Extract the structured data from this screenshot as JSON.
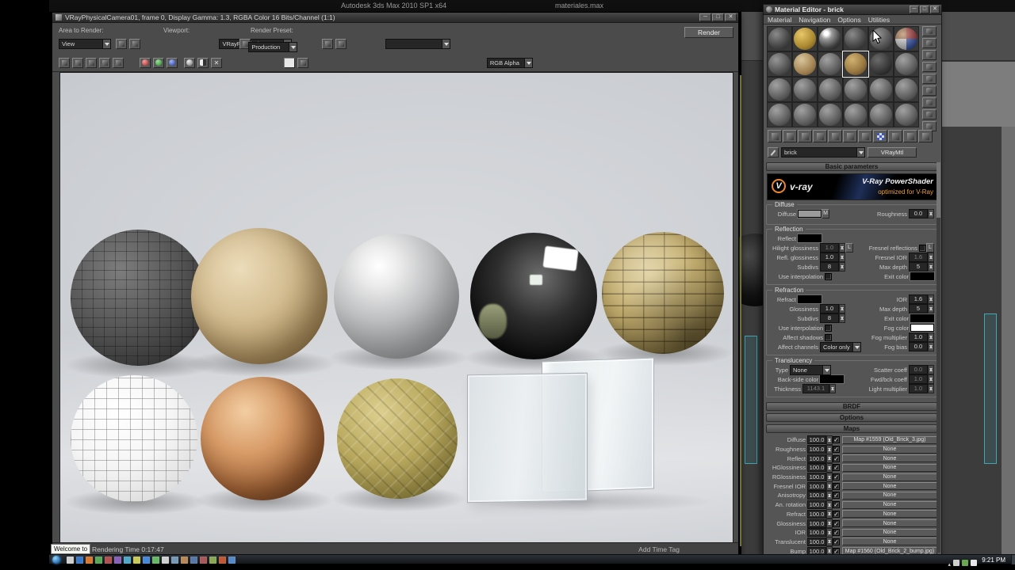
{
  "window": {
    "app_title": "Autodesk 3ds Max 2010 SP1 x64",
    "doc_title": "materiales.max"
  },
  "render_window": {
    "title": "VRayPhysicalCamera01, frame 0, Display Gamma: 1.3, RGBA Color 16 Bits/Channel (1:1)",
    "area_to_render_label": "Area to Render:",
    "area_to_render_value": "View",
    "viewport_label": "Viewport:",
    "viewport_value": "VRayPhysicalCam",
    "render_preset_label": "Render Preset:",
    "render_button_label": "Render",
    "render_mode_value": "Production",
    "channel_display_value": "RGB Alpha",
    "rendering_time": "Rendering Time 0:17:47",
    "add_time_tag": "Add Time Tag",
    "tooltip": "Welcome to M"
  },
  "material_editor": {
    "title": "Material Editor - brick",
    "menu": [
      "Material",
      "Navigation",
      "Options",
      "Utilities"
    ],
    "sample_slots": [
      "bumpy-dark",
      "gold",
      "glossy",
      "bumpy-dark",
      "bumpy-gray",
      "checker",
      "bumpy-gray",
      "tan",
      "gray",
      "brick sel",
      "dark",
      "gray",
      "gray",
      "gray",
      "gray",
      "gray",
      "gray",
      "gray",
      "gray",
      "gray",
      "gray",
      "gray",
      "gray",
      "gray"
    ],
    "material_name": "brick",
    "material_type": "VRayMtl",
    "lock_label": "L",
    "map_shortcut_label": "M",
    "rollouts": {
      "basic": "Basic parameters",
      "brdf": "BRDF",
      "options": "Options",
      "maps": "Maps"
    },
    "banner": {
      "logo_letter": "V",
      "logo_text": "v-ray",
      "title": "V-Ray PowerShader",
      "subtitle": "optimized for V-Ray"
    },
    "groups": {
      "diffuse": "Diffuse",
      "reflection": "Reflection",
      "refraction": "Refraction",
      "translucency": "Translucency"
    },
    "params": {
      "diffuse_label": "Diffuse",
      "roughness_label": "Roughness",
      "roughness_value": "0.0",
      "reflect_label": "Reflect",
      "hilight_glossiness_label": "Hilight glossiness",
      "hilight_glossiness_value": "1.0",
      "fresnel_reflections_label": "Fresnel reflections",
      "refl_glossiness_label": "Refl. glossiness",
      "refl_glossiness_value": "1.0",
      "fresnel_ior_label": "Fresnel IOR",
      "fresnel_ior_value": "1.6",
      "subdivs_label": "Subdivs",
      "reflect_subdivs_value": "8",
      "max_depth_label": "Max depth",
      "reflect_max_depth_value": "5",
      "use_interpolation_label": "Use interpolation",
      "exit_color_label": "Exit color",
      "refract_label": "Refract",
      "ior_label": "IOR",
      "ior_value": "1.6",
      "refract_glossiness_label": "Glossiness",
      "refract_glossiness_value": "1.0",
      "refract_max_depth_value": "5",
      "refract_subdivs_value": "8",
      "fog_color_label": "Fog color",
      "affect_shadows_label": "Affect shadows",
      "fog_multiplier_label": "Fog multiplier",
      "fog_multiplier_value": "1.0",
      "affect_channels_label": "Affect channels",
      "affect_channels_value": "Color only",
      "fog_bias_label": "Fog bias",
      "fog_bias_value": "0.0",
      "type_label": "Type",
      "type_value": "None",
      "scatter_coeff_label": "Scatter coeff",
      "scatter_coeff_value": "0.0",
      "back_side_color_label": "Back-side color",
      "fwd_bck_coeff_label": "Fwd/bck coeff",
      "fwd_bck_coeff_value": "1.0",
      "thickness_label": "Thickness",
      "thickness_value": "1143.1",
      "light_multiplier_label": "Light multiplier",
      "light_multiplier_value": "1.0"
    },
    "swatches": {
      "diffuse": "#9a9a9a",
      "reflect": "#000000",
      "reflect_exit": "#000000",
      "refract": "#000000",
      "refract_exit": "#000000",
      "fog": "#ffffff",
      "back_side": "#000000"
    },
    "maps_rows": [
      {
        "label": "Diffuse",
        "amount": "100.0",
        "map": "Map #1559 (Old_Brick_3.jpg)"
      },
      {
        "label": "Roughness",
        "amount": "100.0",
        "map": "None"
      },
      {
        "label": "Reflect",
        "amount": "100.0",
        "map": "None"
      },
      {
        "label": "HGlossiness",
        "amount": "100.0",
        "map": "None"
      },
      {
        "label": "RGlossiness",
        "amount": "100.0",
        "map": "None"
      },
      {
        "label": "Fresnel IOR",
        "amount": "100.0",
        "map": "None"
      },
      {
        "label": "Anisotropy",
        "amount": "100.0",
        "map": "None"
      },
      {
        "label": "An. rotation",
        "amount": "100.0",
        "map": "None"
      },
      {
        "label": "Refract",
        "amount": "100.0",
        "map": "None"
      },
      {
        "label": "Glossiness",
        "amount": "100.0",
        "map": "None"
      },
      {
        "label": "IOR",
        "amount": "100.0",
        "map": "None"
      },
      {
        "label": "Translucent",
        "amount": "100.0",
        "map": "None"
      },
      {
        "label": "Bump",
        "amount": "100.0",
        "map": "Map #1560 (Old_Brick_2_bump.jpg)"
      }
    ]
  },
  "taskbar": {
    "time": "9:21 PM",
    "icon_colors": [
      "#cfcfcf",
      "#3a78c8",
      "#d87830",
      "#58a858",
      "#b05050",
      "#8860b8",
      "#50a8c8",
      "#c8c858",
      "#4888d8",
      "#68b868",
      "#d0d0d0",
      "#7898b8",
      "#b88858",
      "#5878a8",
      "#a85858",
      "#88a858",
      "#c05838",
      "#5888c8"
    ],
    "tray_colors": [
      "#cfcfcf",
      "#6aa84f",
      "#e8e8e8"
    ]
  }
}
